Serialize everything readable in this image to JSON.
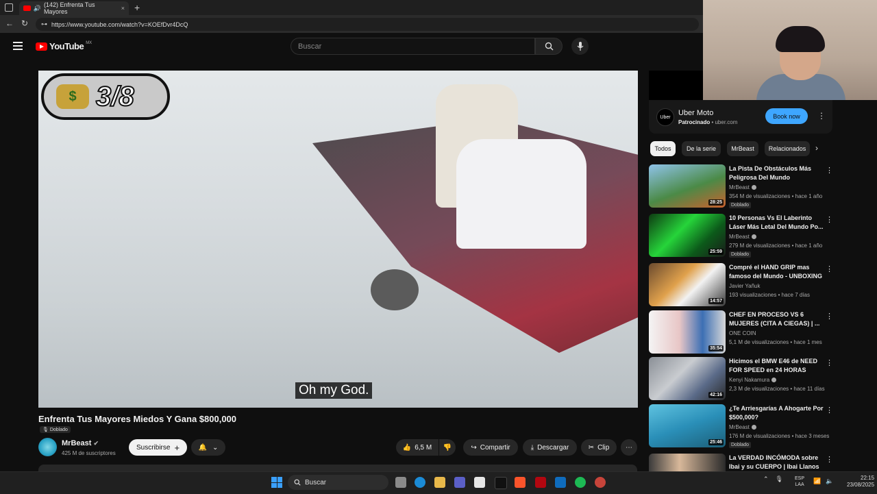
{
  "browser": {
    "tab_title": "(142) Enfrenta Tus Mayores",
    "tab_close": "×",
    "new_tab": "+",
    "url": "https://www.youtube.com/watch?v=KOEfDvr4DcQ"
  },
  "header": {
    "logo_text": "YouTube",
    "region": "MX",
    "search_placeholder": "Buscar"
  },
  "video": {
    "badge_count": "3/8",
    "badge_symbol": "$",
    "subtitle": "Oh my God.",
    "title": "Enfrenta Tus Mayores Miedos Y Gana $800,000",
    "dubbed_label": "Doblado"
  },
  "channel": {
    "name": "MrBeast",
    "subscribers": "425 M de suscriptores",
    "subscribe_label": "Suscribirse"
  },
  "actions": {
    "likes": "6,5 M",
    "share": "Compartir",
    "download": "Descargar",
    "clip": "Clip"
  },
  "ad": {
    "logo": "Uber",
    "title": "Uber Moto",
    "sponsored": "Patrocinado",
    "domain": "uber.com",
    "button": "Book now"
  },
  "chips": [
    "Todos",
    "De la serie",
    "MrBeast",
    "Relacionados"
  ],
  "recommendations": [
    {
      "title": "La Pista De Obstáculos Más Peligrosa Del Mundo",
      "channel": "MrBeast",
      "meta": "354 M de visualizaciones • hace 1 año",
      "duration": "28:25",
      "dubbed": "Doblado",
      "verified": true
    },
    {
      "title": "10 Personas Vs El Laberinto Láser Más Letal Del Mundo Po...",
      "channel": "MrBeast",
      "meta": "279 M de visualizaciones • hace 1 año",
      "duration": "25:59",
      "dubbed": "Doblado",
      "verified": true
    },
    {
      "title": "Compré el HAND GRIP mas famoso del Mundo - UNBOXING",
      "channel": "Javier Yañuk",
      "meta": "193 visualizaciones • hace 7 días",
      "duration": "14:57",
      "dubbed": "",
      "verified": false
    },
    {
      "title": "CHEF EN PROCESO VS 6 MUJERES (CITA A CIEGAS) | ...",
      "channel": "ONE COIN",
      "meta": "5,1 M de visualizaciones • hace 1 mes",
      "duration": "35:54",
      "dubbed": "",
      "verified": false
    },
    {
      "title": "Hicimos el BMW E46 de NEED FOR SPEED en 24 HORAS",
      "channel": "Kenyi Nakamura",
      "meta": "2,3 M de visualizaciones • hace 11 días",
      "duration": "42:16",
      "dubbed": "",
      "verified": true
    },
    {
      "title": "¿Te Arriesgarías A Ahogarte Por $500,000?",
      "channel": "MrBeast",
      "meta": "176 M de visualizaciones • hace 3 meses",
      "duration": "25:46",
      "dubbed": "Doblado",
      "verified": true
    },
    {
      "title": "La VERDAD INCÓMODA sobre Ibai y su CUERPO | Ibai Llanos ...",
      "channel": "",
      "meta": "",
      "duration": "",
      "dubbed": "",
      "verified": false
    }
  ],
  "taskbar": {
    "search": "Buscar",
    "lang_top": "ESP",
    "lang_bottom": "LAA",
    "time": "22:15",
    "date": "23/08/2025"
  },
  "colors": {
    "background": "#0f0f0f",
    "accent_red": "#ff0000",
    "book_button": "#3ea6ff"
  }
}
